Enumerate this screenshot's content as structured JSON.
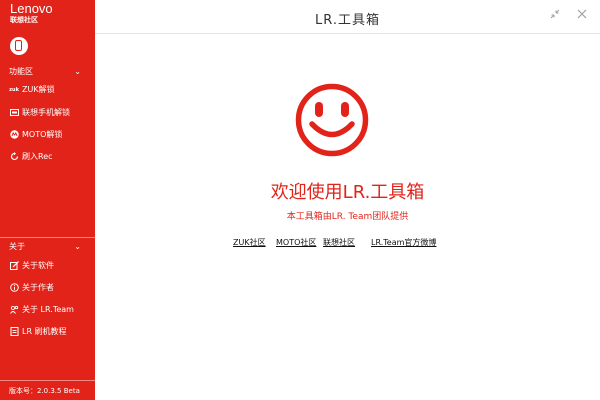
{
  "sidebar": {
    "logo": {
      "main": "Lenovo",
      "sub": "联想社区"
    },
    "sections": [
      {
        "label": "功能区",
        "items": [
          {
            "label": "ZUK解锁",
            "icon": "zuk-icon"
          },
          {
            "label": "联想手机解锁",
            "icon": "lenovo-icon"
          },
          {
            "label": "MOTO解锁",
            "icon": "moto-icon"
          },
          {
            "label": "刷入Rec",
            "icon": "refresh-icon"
          }
        ]
      },
      {
        "label": "关于",
        "items": [
          {
            "label": "关于软件",
            "icon": "edit-icon"
          },
          {
            "label": "关于作者",
            "icon": "info-icon"
          },
          {
            "label": "关于 LR.Team",
            "icon": "team-icon"
          },
          {
            "label": "LR 刷机教程",
            "icon": "document-icon"
          }
        ]
      }
    ],
    "version": "版本号：2.0.3.5 Beta"
  },
  "titlebar": {
    "title": "LR.工具箱"
  },
  "main": {
    "welcome": "欢迎使用LR.工具箱",
    "subtitle": "本工具箱由LR. Team团队提供",
    "links": [
      "ZUK社区",
      "MOTO社区",
      "联想社区",
      "LR.Team官方微博"
    ]
  },
  "colors": {
    "accent": "#e2231a"
  }
}
